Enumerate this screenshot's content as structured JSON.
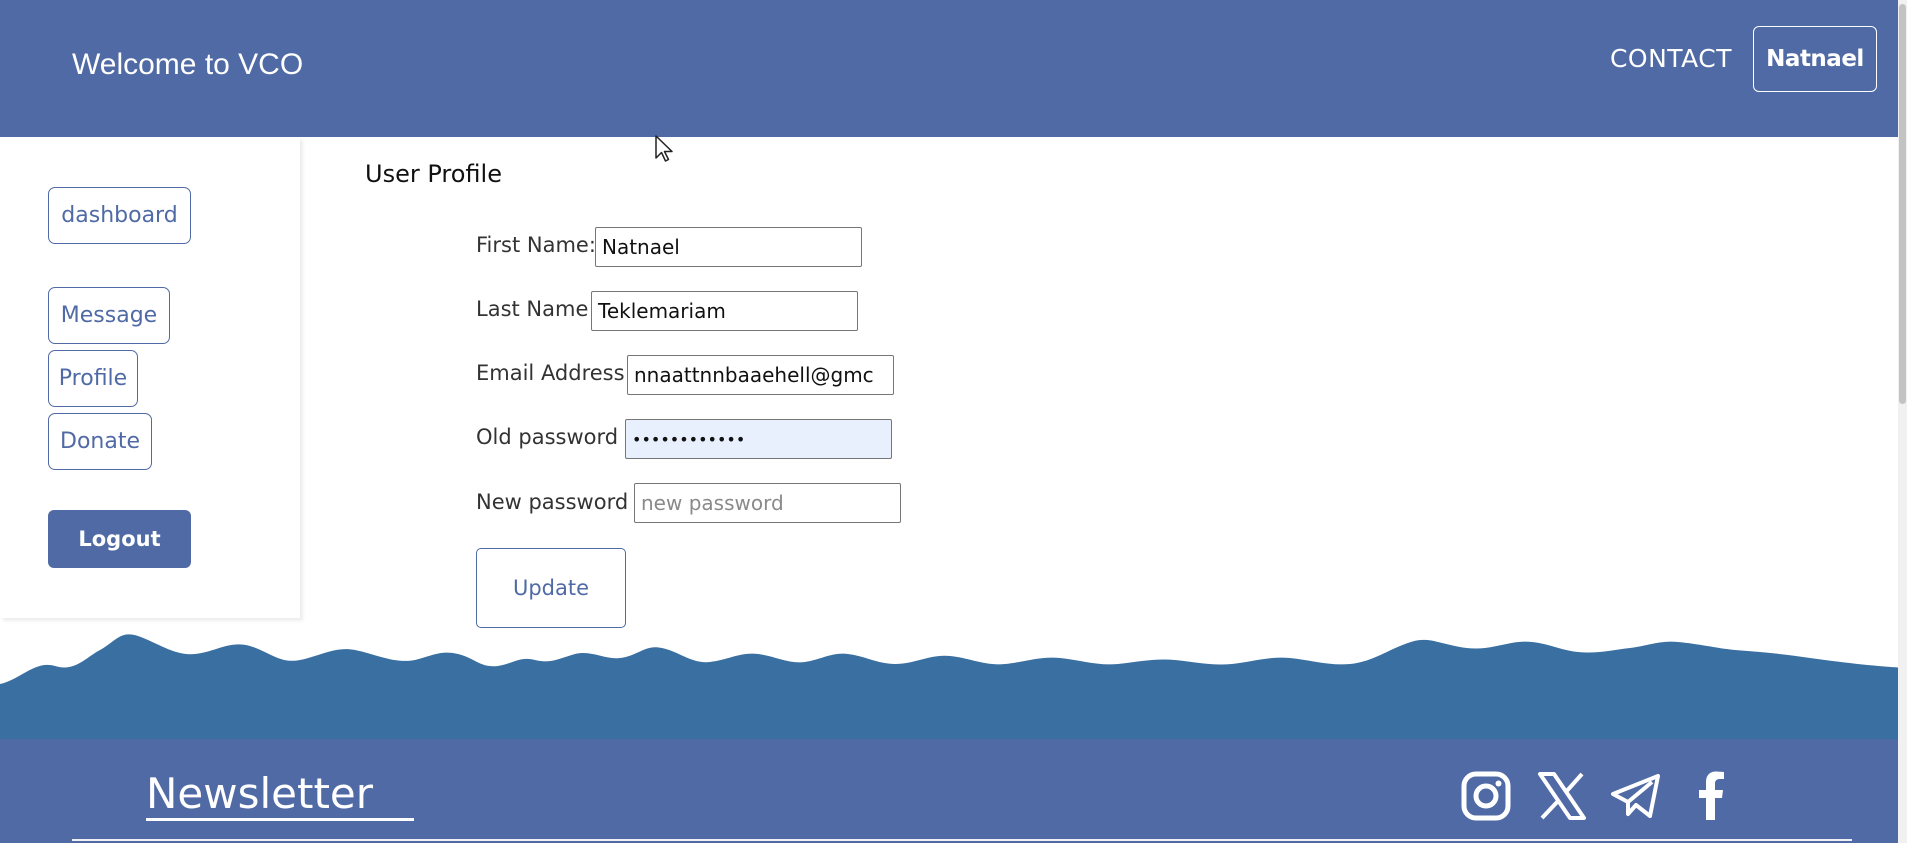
{
  "header": {
    "title": "Welcome to VCO",
    "contact_label": "CONTACT",
    "user_label": "Natnael"
  },
  "sidebar": {
    "items": [
      {
        "label": "dashboard"
      },
      {
        "label": "Message"
      },
      {
        "label": "Profile"
      },
      {
        "label": "Donate"
      }
    ],
    "logout_label": "Logout"
  },
  "profile": {
    "title": "User Profile",
    "fields": [
      {
        "label": "First Name:",
        "value": "Natnael",
        "placeholder": ""
      },
      {
        "label": "Last Name",
        "value": "Teklemariam",
        "placeholder": ""
      },
      {
        "label": "Email Address",
        "value": "nnaattnnbaaehell@gmc",
        "placeholder": ""
      },
      {
        "label": "Old password",
        "value": "••••••••••••",
        "placeholder": ""
      },
      {
        "label": "New password",
        "value": "",
        "placeholder": "new password"
      }
    ],
    "update_label": "Update"
  },
  "footer": {
    "newsletter_title": "Newsletter",
    "social_icons": [
      "instagram-icon",
      "x-icon",
      "telegram-icon",
      "facebook-icon"
    ]
  },
  "colors": {
    "brand": "#506aa5",
    "wave": "#3a6fa1",
    "autofill": "#e8f0fe"
  }
}
